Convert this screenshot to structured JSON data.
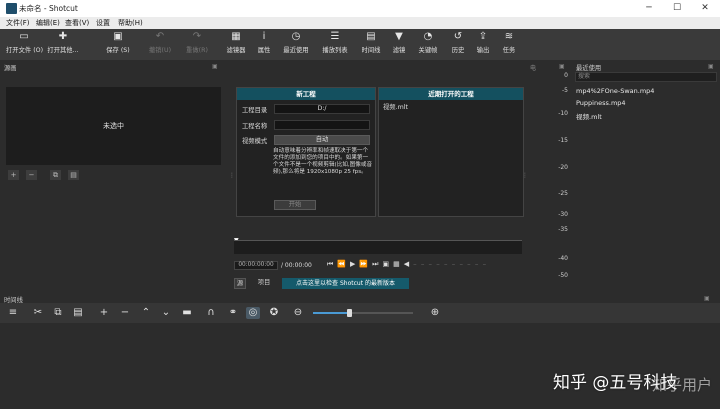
{
  "window": {
    "title": "未命名 - Shotcut",
    "min": "─",
    "max": "☐",
    "close": "✕"
  },
  "menu": [
    "文件(F)",
    "编辑(E)",
    "查看(V)",
    "设置",
    "帮助(H)"
  ],
  "toolbar": [
    {
      "label": "打开文件 (O)",
      "icon": "folder-icon",
      "glyph": "▭"
    },
    {
      "label": "打开其他...",
      "icon": "open-other-icon",
      "glyph": "✚"
    },
    {
      "label": "保存 (S)",
      "icon": "save-icon",
      "glyph": "▣"
    },
    {
      "label": "撤销(U)",
      "icon": "undo-icon",
      "glyph": "↶"
    },
    {
      "label": "重做(R)",
      "icon": "redo-icon",
      "glyph": "↷"
    },
    {
      "label": "滤镜器",
      "icon": "filter-icon",
      "glyph": "▦"
    },
    {
      "label": "属性",
      "icon": "info-icon",
      "glyph": "i"
    },
    {
      "label": "最近使用",
      "icon": "clock-icon",
      "glyph": "◷"
    },
    {
      "label": "播放列表",
      "icon": "playlist-icon",
      "glyph": "☰"
    },
    {
      "label": "时间线",
      "icon": "timeline-icon",
      "glyph": "▤"
    },
    {
      "label": "滤镜",
      "icon": "funnel-icon",
      "glyph": "▼"
    },
    {
      "label": "关键帧",
      "icon": "keyframe-icon",
      "glyph": "◔"
    },
    {
      "label": "历史",
      "icon": "history-icon",
      "glyph": "↺"
    },
    {
      "label": "输出",
      "icon": "export-icon",
      "glyph": "⇪"
    },
    {
      "label": "任务",
      "icon": "jobs-icon",
      "glyph": "≋"
    }
  ],
  "left_panel": {
    "title": "源画",
    "player_text": "未选中"
  },
  "new_project": {
    "header": "新工程",
    "dir_label": "工程目录",
    "dir_value": "D:/",
    "name_label": "工程名称",
    "name_value": "",
    "mode_label": "视频模式",
    "mode_value": "自动",
    "desc": "自动意味着分辨率和帧速取决于第一个文件的添加到您的项目中的。如果第一个文件不是一个视频剪辑(比如,图像或音频),那么将是 1920x1080p 25 fps。",
    "start_btn": "开始"
  },
  "recent_projects": {
    "header": "近期打开的工程",
    "items": [
      "视频.mlt"
    ]
  },
  "player_bar": {
    "timecode": "00:00:00:00",
    "duration": "/ 00:00:00",
    "tab_source": "源",
    "tab_project": "项目",
    "update_banner": "点击这里以检查 Shotcut 的最新版本"
  },
  "meter": {
    "labels": [
      "0",
      "-5",
      "-10",
      "-15",
      "-20",
      "-25",
      "-30",
      "-35",
      "-40",
      "-50"
    ]
  },
  "recent": {
    "title": "最近使用",
    "search_placeholder": "搜索",
    "items": [
      "mp4%2FOne-Swan.mp4",
      "Puppiness.mp4",
      "视频.mlt"
    ]
  },
  "timeline": {
    "title": "时间线"
  },
  "watermark": {
    "text1": "知乎 @五号科技",
    "text2": "知乎用户"
  },
  "colors": {
    "accent": "#14505f",
    "bg": "#2c2c2c",
    "update_banner": "#155a6b"
  }
}
